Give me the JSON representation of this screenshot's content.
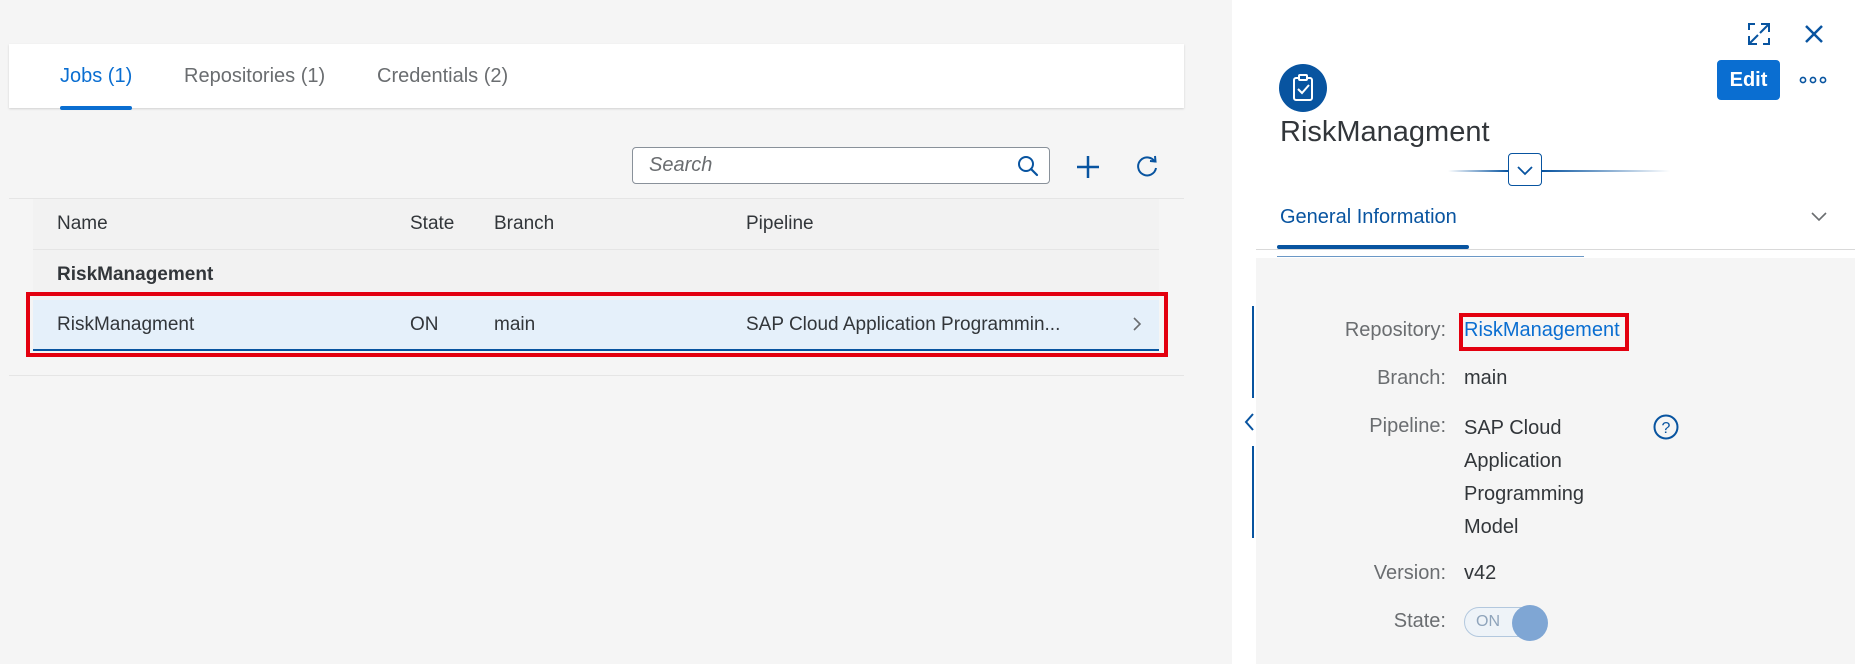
{
  "tabs": [
    {
      "label": "Jobs (1)",
      "active": true
    },
    {
      "label": "Repositories (1)",
      "active": false
    },
    {
      "label": "Credentials (2)",
      "active": false
    }
  ],
  "search": {
    "placeholder": "Search",
    "value": ""
  },
  "toolbar": {
    "add_icon": "plus-icon",
    "refresh_icon": "refresh-icon"
  },
  "table": {
    "columns": [
      "Name",
      "State",
      "Branch",
      "Pipeline"
    ],
    "group_label": "RiskManagement",
    "rows": [
      {
        "name": "RiskManagment",
        "state": "ON",
        "branch": "main",
        "pipeline": "SAP Cloud Application Programmin..."
      }
    ]
  },
  "detail": {
    "avatar_icon": "clipboard-check-icon",
    "title": "RiskManagment",
    "edit_label": "Edit",
    "section_tab": "General Information",
    "fields": {
      "repository_label": "Repository:",
      "repository_value": "RiskManagement",
      "branch_label": "Branch:",
      "branch_value": "main",
      "pipeline_label": "Pipeline:",
      "pipeline_value": "SAP Cloud Application Programming Model",
      "version_label": "Version:",
      "version_value": "v42",
      "state_label": "State:",
      "state_value": "ON"
    }
  },
  "colors": {
    "accent": "#0a6ed1",
    "highlight": "#e3000f",
    "selected_row": "#e5f0fa"
  }
}
